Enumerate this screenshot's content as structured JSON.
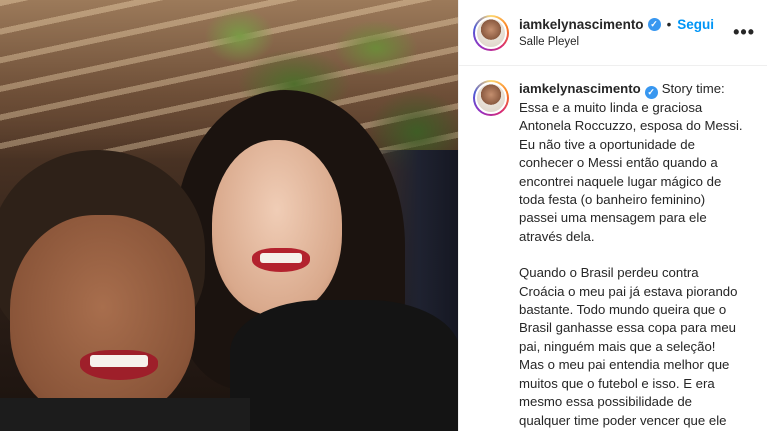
{
  "post": {
    "username": "iamkelynascimento",
    "follow_label": "Segui",
    "separator": "•",
    "location": "Salle Pleyel",
    "more_label": "•••"
  },
  "caption": {
    "username": "iamkelynascimento",
    "paragraph1": "Story time:\nEssa e a muito linda e graciosa\nAntonela Roccuzzo, esposa do Messi.\nEu não tive a oportunidade de\nconhecer o Messi então quando a\nencontrei naquele lugar mágico de\ntoda festa (o banheiro feminino)\npassei uma mensagem para ele\natravés dela.",
    "paragraph2": "Quando o Brasil perdeu contra\nCroácia o meu pai já estava piorando\nbastante. Todo mundo queira que o\nBrasil ganhasse essa copa para meu\npai, ninguém mais que a seleção!\nMas o meu pai entendia melhor que\nmuitos que o futebol e isso. E era\nmesmo essa possibilidade de\nqualquer time poder vencer que ele"
  },
  "icons": {
    "verified": "verified-badge-icon",
    "more": "more-options-icon"
  },
  "colors": {
    "follow": "#0095f6",
    "verified": "#3897f0",
    "text": "#262626"
  }
}
